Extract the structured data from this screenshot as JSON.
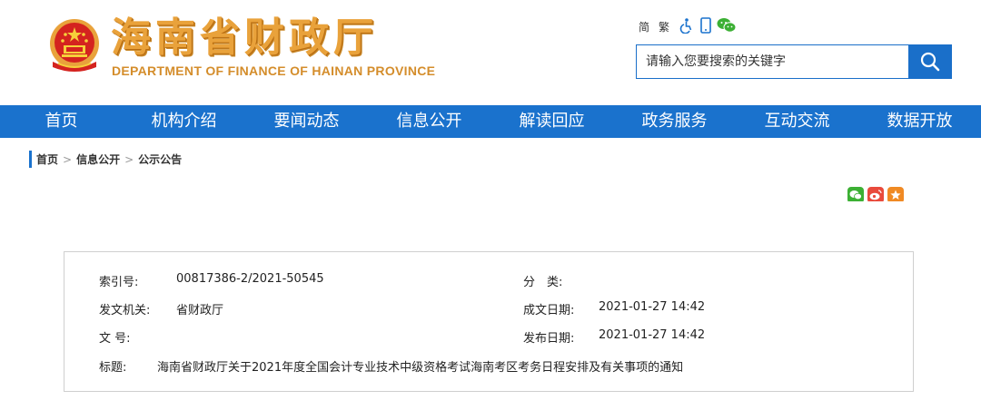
{
  "header": {
    "site_title": "海南省财政厅",
    "site_subtitle": "DEPARTMENT OF FINANCE OF HAINAN PROVINCE",
    "tools": {
      "simplified": "简",
      "traditional": "繁"
    },
    "search": {
      "placeholder": "请输入您要搜索的关键字"
    }
  },
  "nav": {
    "items": [
      {
        "label": "首页"
      },
      {
        "label": "机构介绍"
      },
      {
        "label": "要闻动态"
      },
      {
        "label": "信息公开"
      },
      {
        "label": "解读回应"
      },
      {
        "label": "政务服务"
      },
      {
        "label": "互动交流"
      },
      {
        "label": "数据开放"
      }
    ]
  },
  "breadcrumb": {
    "items": [
      "首页",
      "信息公开",
      "公示公告"
    ],
    "separator": ">"
  },
  "info": {
    "index_label": "索引号:",
    "index_value": "00817386-2/2021-50545",
    "category_label": "分　类:",
    "category_value": "",
    "issuer_label": "发文机关:",
    "issuer_value": "省财政厅",
    "written_date_label": "成文日期:",
    "written_date_value": "2021-01-27 14:42",
    "doc_no_label": "文 号:",
    "doc_no_value": "",
    "publish_date_label": "发布日期:",
    "publish_date_value": "2021-01-27 14:42",
    "title_label": "标题:",
    "title_value": "海南省财政厅关于2021年度全国会计专业技术中级资格考试海南考区考务日程安排及有关事项的通知"
  },
  "colors": {
    "brand_blue": "#1a72cd",
    "title_gold": "#e9a23b",
    "emblem_red": "#d4231f",
    "wechat_green": "#3cb034",
    "weibo_red": "#e94a3c",
    "qzone_orange": "#f08a24"
  }
}
